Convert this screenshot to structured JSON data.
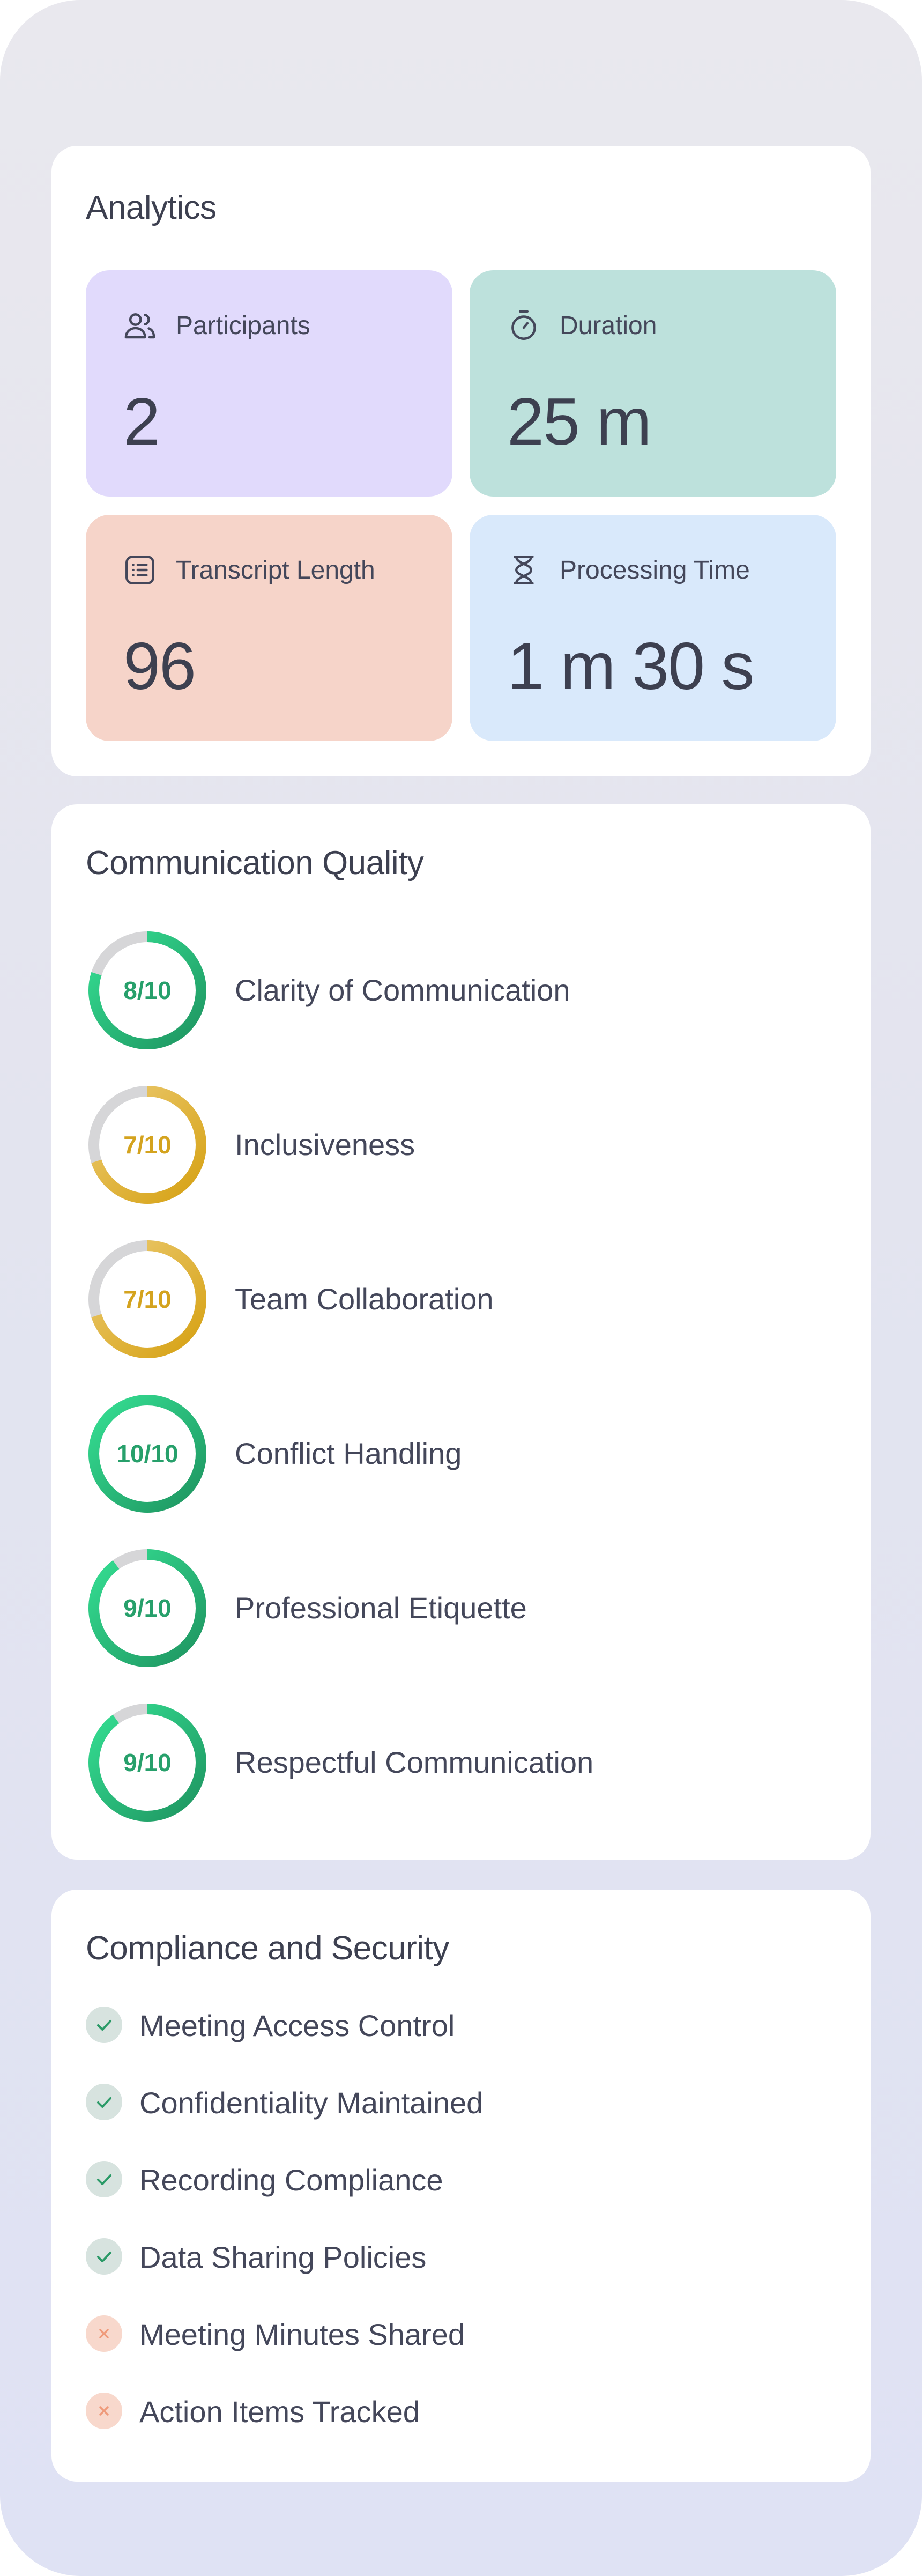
{
  "analytics": {
    "title": "Analytics",
    "stats": [
      {
        "label": "Participants",
        "value": "2",
        "icon": "users-icon",
        "color": "#e1dafc"
      },
      {
        "label": "Duration",
        "value": "25 m",
        "icon": "stopwatch-icon",
        "color": "#bde1dc"
      },
      {
        "label": "Transcript Length",
        "value": "96",
        "icon": "list-icon",
        "color": "#f6d4c9"
      },
      {
        "label": "Processing Time",
        "value": "1 m 30 s",
        "icon": "hourglass-icon",
        "color": "#d9e9fb"
      }
    ]
  },
  "quality": {
    "title": "Communication Quality",
    "items": [
      {
        "score": "8/10",
        "value": 8,
        "max": 10,
        "label": "Clarity of Communication",
        "color": "#27a06b"
      },
      {
        "score": "7/10",
        "value": 7,
        "max": 10,
        "label": "Inclusiveness",
        "color": "#d4a31e"
      },
      {
        "score": "7/10",
        "value": 7,
        "max": 10,
        "label": "Team Collaboration",
        "color": "#d4a31e"
      },
      {
        "score": "10/10",
        "value": 10,
        "max": 10,
        "label": "Conflict Handling",
        "color": "#27a06b"
      },
      {
        "score": "9/10",
        "value": 9,
        "max": 10,
        "label": "Professional Etiquette",
        "color": "#27a06b"
      },
      {
        "score": "9/10",
        "value": 9,
        "max": 10,
        "label": "Respectful Communication",
        "color": "#27a06b"
      }
    ]
  },
  "compliance": {
    "title": "Compliance and Security",
    "items": [
      {
        "label": "Meeting Access Control",
        "status": "pass",
        "icon": "check-icon"
      },
      {
        "label": "Confidentiality Maintained",
        "status": "pass",
        "icon": "check-icon"
      },
      {
        "label": "Recording Compliance",
        "status": "pass",
        "icon": "check-icon"
      },
      {
        "label": "Data Sharing Policies",
        "status": "pass",
        "icon": "check-icon"
      },
      {
        "label": "Meeting Minutes Shared",
        "status": "fail",
        "icon": "x-icon"
      },
      {
        "label": "Action Items Tracked",
        "status": "fail",
        "icon": "x-icon"
      }
    ],
    "colors": {
      "pass_bg": "#d7e3df",
      "pass_fg": "#2a9a67",
      "fail_bg": "#f8d8cc",
      "fail_fg": "#ef9a7a"
    }
  }
}
